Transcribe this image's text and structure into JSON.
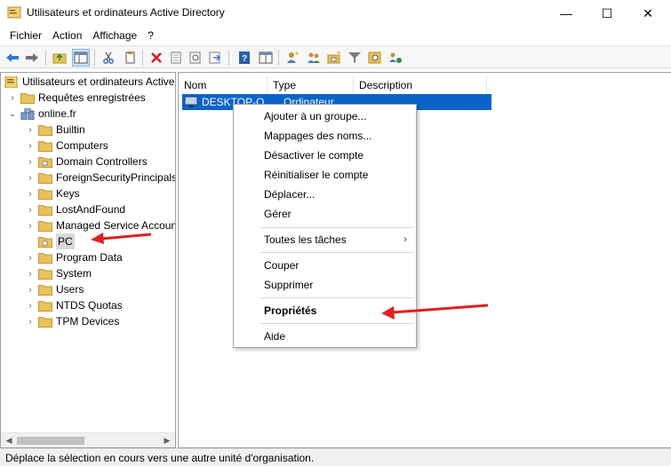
{
  "window": {
    "title": "Utilisateurs et ordinateurs Active Directory",
    "minimize_glyph": "—",
    "maximize_glyph": "☐",
    "close_glyph": "✕"
  },
  "menubar": {
    "items": [
      "Fichier",
      "Action",
      "Affichage",
      "?"
    ]
  },
  "toolbar": {
    "icons": [
      "back-icon",
      "forward-icon",
      "up-folder-icon",
      "console-tree-icon",
      "cut-icon",
      "copy-icon",
      "delete-icon",
      "properties-icon",
      "refresh-icon",
      "export-icon",
      "help-icon",
      "mmc-icon",
      "new-user-icon",
      "new-group-icon",
      "new-ou-icon",
      "filter-icon",
      "find-icon",
      "add-to-group-icon"
    ]
  },
  "tree": {
    "root": "Utilisateurs et ordinateurs Active Directory",
    "saved_queries": "Requêtes enregistrées",
    "domain": "online.fr",
    "children": [
      "Builtin",
      "Computers",
      "Domain Controllers",
      "ForeignSecurityPrincipals",
      "Keys",
      "LostAndFound",
      "Managed Service Accounts",
      "PC",
      "Program Data",
      "System",
      "Users",
      "NTDS Quotas",
      "TPM Devices"
    ],
    "selected": "PC"
  },
  "list": {
    "columns": [
      "Nom",
      "Type",
      "Description"
    ],
    "rows": [
      {
        "name": "DESKTOP-O",
        "type": "Ordinateur",
        "description": ""
      }
    ]
  },
  "context_menu": {
    "items": [
      "Ajouter à un groupe...",
      "Mappages des noms...",
      "Désactiver le compte",
      "Réinitialiser le compte",
      "Déplacer...",
      "Gérer",
      "Toutes les tâches",
      "Couper",
      "Supprimer",
      "Propriétés",
      "Aide"
    ],
    "submenu_glyph": "›"
  },
  "statusbar": {
    "text": "Déplace la sélection en cours vers une autre unité d'organisation."
  },
  "colors": {
    "selection": "#0a64c8",
    "annotation_arrow": "#e02020",
    "folder": "#e8c25a"
  }
}
